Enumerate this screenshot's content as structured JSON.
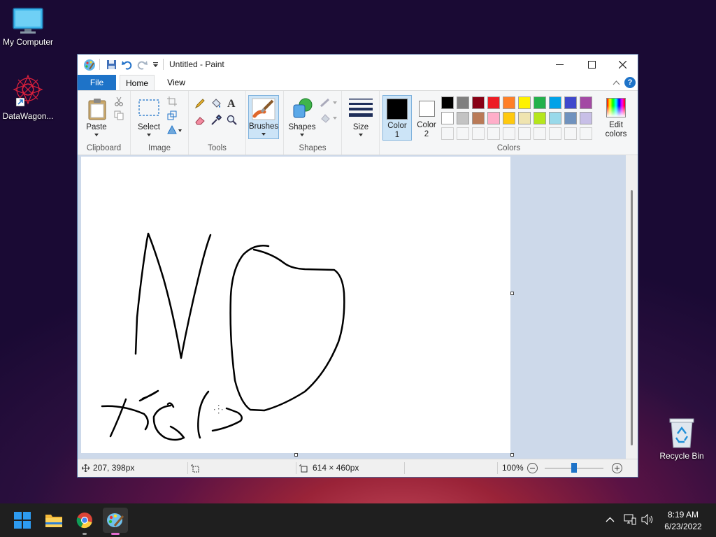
{
  "desktop": {
    "icons": [
      {
        "label": "My Computer"
      },
      {
        "label": "DataWagon..."
      },
      {
        "label": "Recycle Bin"
      }
    ]
  },
  "window": {
    "title": "Untitled - Paint",
    "tabs": [
      {
        "label": "File",
        "active": false,
        "accent": "#1e73c8"
      },
      {
        "label": "Home",
        "active": true
      },
      {
        "label": "View",
        "active": false
      }
    ],
    "help_label": "?"
  },
  "ribbon": {
    "clipboard": {
      "group_label": "Clipboard",
      "paste_label": "Paste"
    },
    "image": {
      "group_label": "Image",
      "select_label": "Select"
    },
    "tools": {
      "group_label": "Tools"
    },
    "brushes": {
      "label": "Brushes",
      "selected": true
    },
    "shapes": {
      "group_label": "Shapes",
      "shapes_label": "Shapes"
    },
    "size": {
      "label": "Size"
    },
    "colors": {
      "group_label": "Colors",
      "color1_label": "Color",
      "color1_index": "1",
      "color1_value": "#000000",
      "color2_label": "Color",
      "color2_index": "2",
      "color2_value": "#ffffff",
      "edit_colors_line1": "Edit",
      "edit_colors_line2": "colors",
      "palette_row1": [
        "#000000",
        "#7f7f7f",
        "#880015",
        "#ed1c24",
        "#ff7f27",
        "#fff200",
        "#22b14c",
        "#00a2e8",
        "#3f48cc",
        "#a349a4"
      ],
      "palette_row2": [
        "#ffffff",
        "#c3c3c3",
        "#b97a57",
        "#ffaec9",
        "#ffc90e",
        "#efe4b0",
        "#b5e61d",
        "#99d9ea",
        "#7092be",
        "#c8bfe7"
      ],
      "palette_row3": [
        "",
        "",
        "",
        "",
        "",
        "",
        "",
        "",
        "",
        ""
      ]
    }
  },
  "status": {
    "cursor_pos": "207, 398px",
    "selection_size": "",
    "canvas_size": "614 × 460px",
    "zoom": "100%",
    "zoom_fraction": 0.5
  },
  "taskbar": {
    "apps": [
      "windows-start-icon",
      "file-explorer-icon",
      "chrome-icon",
      "paint-icon"
    ],
    "time": "8:19 AM",
    "date": "6/23/2022"
  }
}
